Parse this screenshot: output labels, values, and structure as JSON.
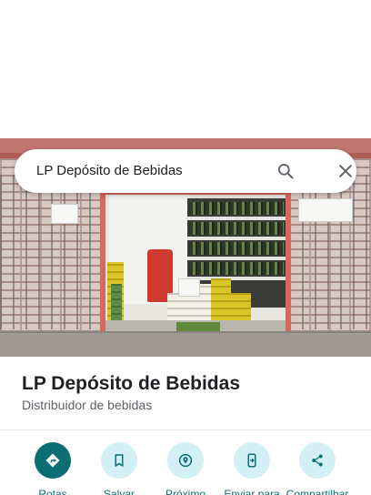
{
  "search": {
    "query": "LP Depósito de Bebidas",
    "search_icon": "search-icon",
    "close_icon": "close-icon"
  },
  "place": {
    "name": "LP Depósito de Bebidas",
    "category": "Distribuidor de bebidas"
  },
  "actions": [
    {
      "label": "Rotas",
      "icon": "directions-icon"
    },
    {
      "label": "Salvar",
      "icon": "bookmark-icon"
    },
    {
      "label": "Próximo",
      "icon": "nearby-icon"
    },
    {
      "label": "Enviar para",
      "icon": "send-to-phone-icon"
    },
    {
      "label": "Compartilhar",
      "icon": "share-icon"
    }
  ],
  "colors": {
    "accent": "#0b6e75",
    "accent_light": "#d2f0f5",
    "text_primary": "#202124",
    "text_secondary": "#5f6368"
  }
}
